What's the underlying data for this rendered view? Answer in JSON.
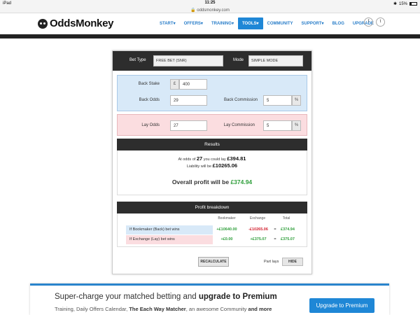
{
  "status": {
    "device": "iPad",
    "time": "11:25",
    "battery": "15%"
  },
  "url": "oddsmonkey.com",
  "brand": {
    "name": "OddsMonkey"
  },
  "nav": [
    "START",
    "OFFERS",
    "TRAINING",
    "TOOLS",
    "COMMUNITY",
    "SUPPORT",
    "BLOG",
    "UPGRADE"
  ],
  "nav_dropdown_marks": [
    "▾",
    "▾",
    "▾",
    "▾",
    "",
    "▾",
    "",
    ""
  ],
  "social": {
    "facebook": "f",
    "twitter": "t"
  },
  "calc": {
    "bet_type_label": "Bet Type",
    "bet_type_value": "FREE BET (SNR)",
    "mode_label": "Mode",
    "mode_value": "SIMPLE MODE",
    "back_stake_label": "Back Stake",
    "currency": "£",
    "back_stake_value": "400",
    "back_odds_label": "Back Odds",
    "back_odds_value": "29",
    "back_commission_label": "Back Commission",
    "back_commission_value": "5",
    "percent": "%",
    "lay_odds_label": "Lay Odds",
    "lay_odds_value": "27",
    "lay_commission_label": "Lay Commission",
    "lay_commission_value": "5"
  },
  "results": {
    "header": "Results",
    "line1_pre": "At odds of",
    "odds": "27",
    "line1_mid": "you could lay",
    "lay_amount": "£394.81",
    "line2_pre": "Liability will be",
    "liability": "£10265.06",
    "overall_label": "Overall profit will be",
    "overall_value": "£374.94"
  },
  "breakdown": {
    "header": "Profit breakdown",
    "columns": [
      "Bookmaker",
      "Exchange",
      "Total"
    ],
    "rows": [
      {
        "name": "If Bookmaker (Back) bet wins",
        "bookmaker": "+£10640.00",
        "exchange": "-£10265.06",
        "eq": "=",
        "total": "£374.94"
      },
      {
        "name": "If Exchange (Lay) bet wins",
        "bookmaker": "+£0.00",
        "exchange": "+£375.07",
        "eq": "=",
        "total": "£375.07"
      }
    ]
  },
  "recalculate_label": "RECALCULATE",
  "part_lays_label": "Part lays",
  "hide_label": "HIDE",
  "promo": {
    "title_pre": "Super-charge your matched betting and",
    "title_bold": "upgrade to Premium",
    "sub_pre": "Training, Daily Offers Calendar,",
    "sub_bold1": "The Each Way Matcher",
    "sub_mid": ", an awesome Community",
    "sub_bold2": "and more",
    "button": "Upgrade to Premium"
  },
  "colors": {
    "accent": "#1f87d6",
    "profit_green": "#2e9e3a",
    "loss_red": "#d21f2e",
    "back_blue": "#d8e9f8",
    "lay_pink": "#fbdde0"
  }
}
